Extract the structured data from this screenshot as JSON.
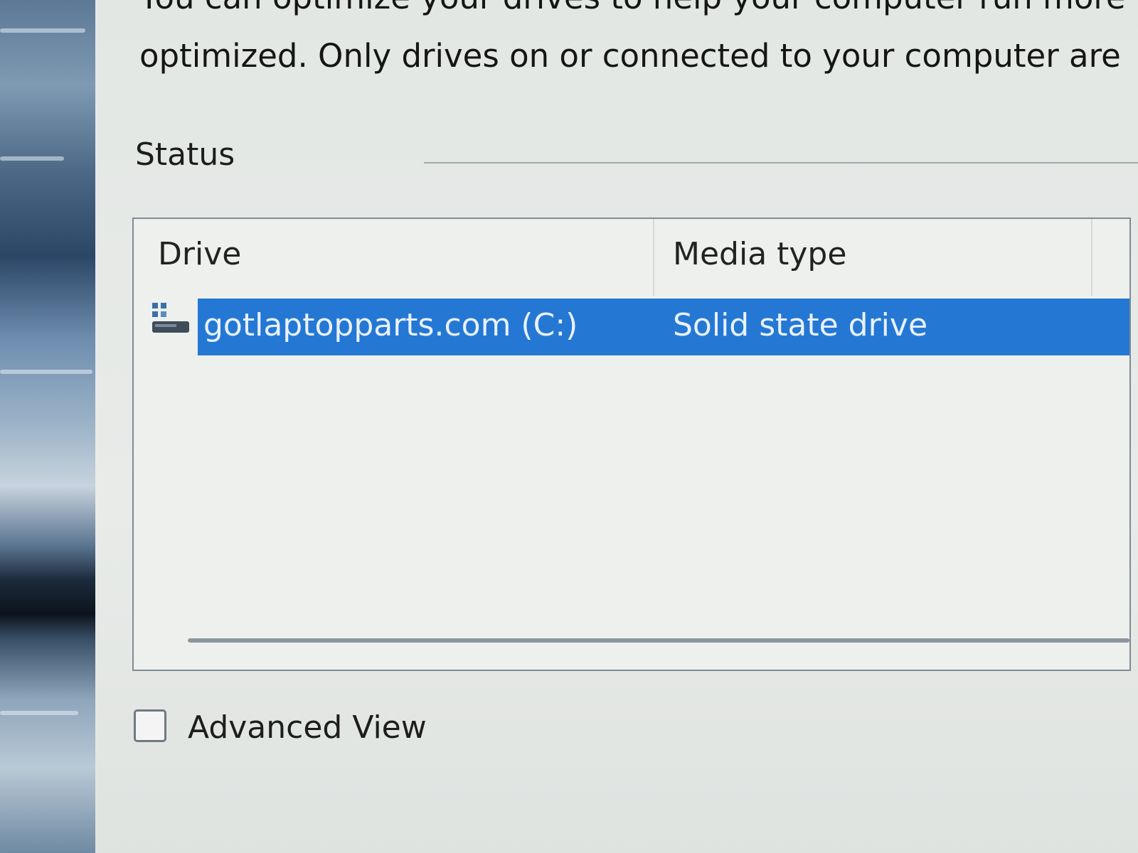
{
  "window": {
    "description_lines": [
      "You can optimize your drives to help your computer run more",
      "optimized. Only drives on or connected to your computer are"
    ]
  },
  "status": {
    "heading": "Status"
  },
  "drive_list": {
    "columns": [
      "Drive",
      "Media type"
    ],
    "rows": [
      {
        "drive": "gotlaptopparts.com (C:)",
        "media_type": "Solid state drive",
        "selected": true,
        "icon": "drive-icon"
      }
    ]
  },
  "advanced_view": {
    "label": "Advanced View",
    "checked": false
  },
  "colors": {
    "selection": "#2478d4",
    "selected_text": "#e9f1fb",
    "dialog_background": "#e5e8e5"
  }
}
